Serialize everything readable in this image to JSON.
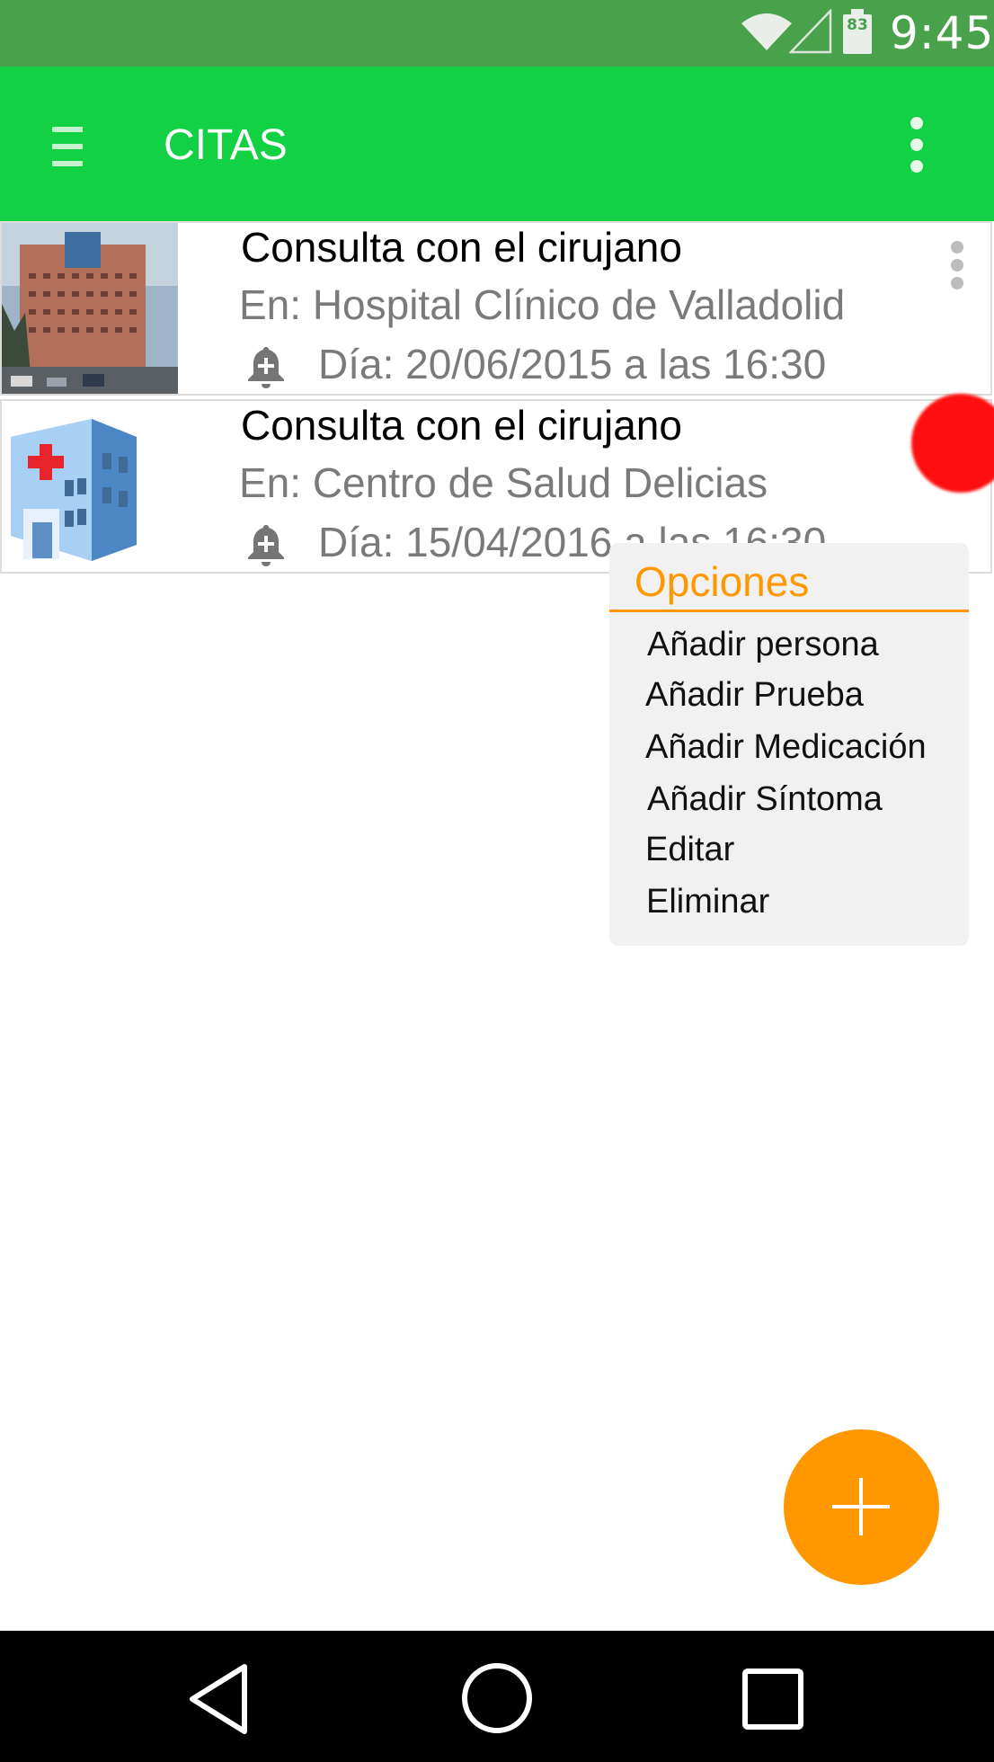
{
  "status_bar": {
    "time": "9:45",
    "battery_level": "83",
    "icons": [
      "wifi-icon",
      "signal-icon",
      "battery-icon"
    ]
  },
  "app_bar": {
    "title": "CITAS",
    "menu_icon": "hamburger-icon",
    "overflow_icon": "more-vert-icon"
  },
  "appointments": [
    {
      "title": "Consulta con el cirujano",
      "place": "En: Hospital Clínico de Valladolid",
      "date": "Día: 20/06/2015 a las 16:30",
      "image": "hospital-building-photo",
      "alarm_icon": "bell-plus-icon"
    },
    {
      "title": "Consulta con el cirujano",
      "place": "En: Centro de Salud Delicias",
      "date": "Día: 15/04/2016 a las 16:30",
      "image": "hospital-clipart-icon",
      "alarm_icon": "bell-plus-icon"
    }
  ],
  "options_menu": {
    "title": "Opciones",
    "items": [
      "Añadir persona",
      "Añadir Prueba",
      "Añadir Medicación",
      "Añadir Síntoma",
      "Editar",
      "Eliminar"
    ]
  },
  "fab": {
    "icon": "plus-icon"
  },
  "nav_bar": {
    "icons": [
      "back-icon",
      "home-icon",
      "recents-icon"
    ]
  },
  "colors": {
    "status_bar": "#4aa14c",
    "app_bar": "#12d144",
    "accent": "#ff9800",
    "touch_indicator": "#ff0f0f"
  }
}
